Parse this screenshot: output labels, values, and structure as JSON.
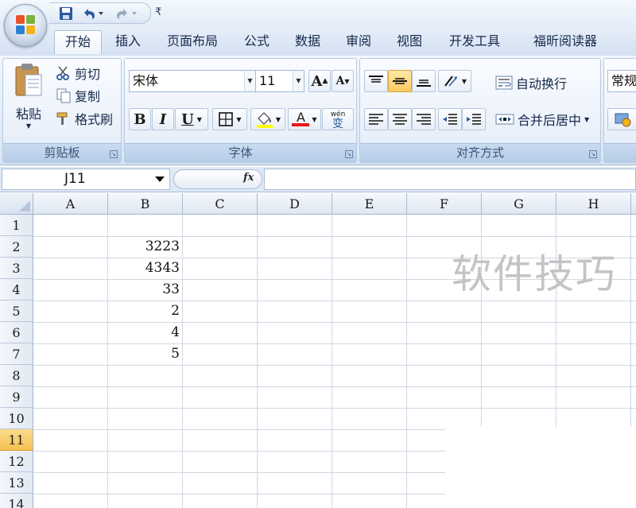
{
  "quick_access": {
    "customize_symbol": "₹"
  },
  "tabs": [
    {
      "label": "开始",
      "active": true
    },
    {
      "label": "插入"
    },
    {
      "label": "页面布局"
    },
    {
      "label": "公式"
    },
    {
      "label": "数据"
    },
    {
      "label": "审阅"
    },
    {
      "label": "视图"
    },
    {
      "label": "开发工具"
    },
    {
      "label": "福昕阅读器"
    }
  ],
  "ribbon": {
    "clipboard": {
      "label": "剪贴板",
      "paste": "粘贴",
      "cut": "剪切",
      "copy": "复制",
      "format_painter": "格式刷"
    },
    "font": {
      "label": "字体",
      "font_name": "宋体",
      "font_size": "11",
      "grow": "A",
      "shrink": "A",
      "bold": "B",
      "italic": "I",
      "underline": "U",
      "font_color_letter": "A",
      "phonetic_top": "wén",
      "phonetic_bottom": "变"
    },
    "alignment": {
      "label": "对齐方式",
      "wrap_text": "自动换行",
      "merge_center": "合并后居中"
    },
    "number": {
      "format": "常规"
    }
  },
  "formula_bar": {
    "name_box": "J11",
    "fx": "fx",
    "value": ""
  },
  "grid": {
    "columns": [
      "A",
      "B",
      "C",
      "D",
      "E",
      "F",
      "G",
      "H"
    ],
    "rows": [
      "1",
      "2",
      "3",
      "4",
      "5",
      "6",
      "7",
      "8",
      "9",
      "10",
      "11",
      "12",
      "13",
      "14"
    ],
    "selected_row": "11",
    "column_b_values": [
      "",
      "3223",
      "4343",
      "33",
      "2",
      "4",
      "5"
    ]
  },
  "watermark": "软件技巧",
  "colors": {
    "accent": "#f5c24f",
    "ribbon_bg": "#dce7f5",
    "font_color": "#e8141b",
    "highlight": "#ffff00"
  }
}
